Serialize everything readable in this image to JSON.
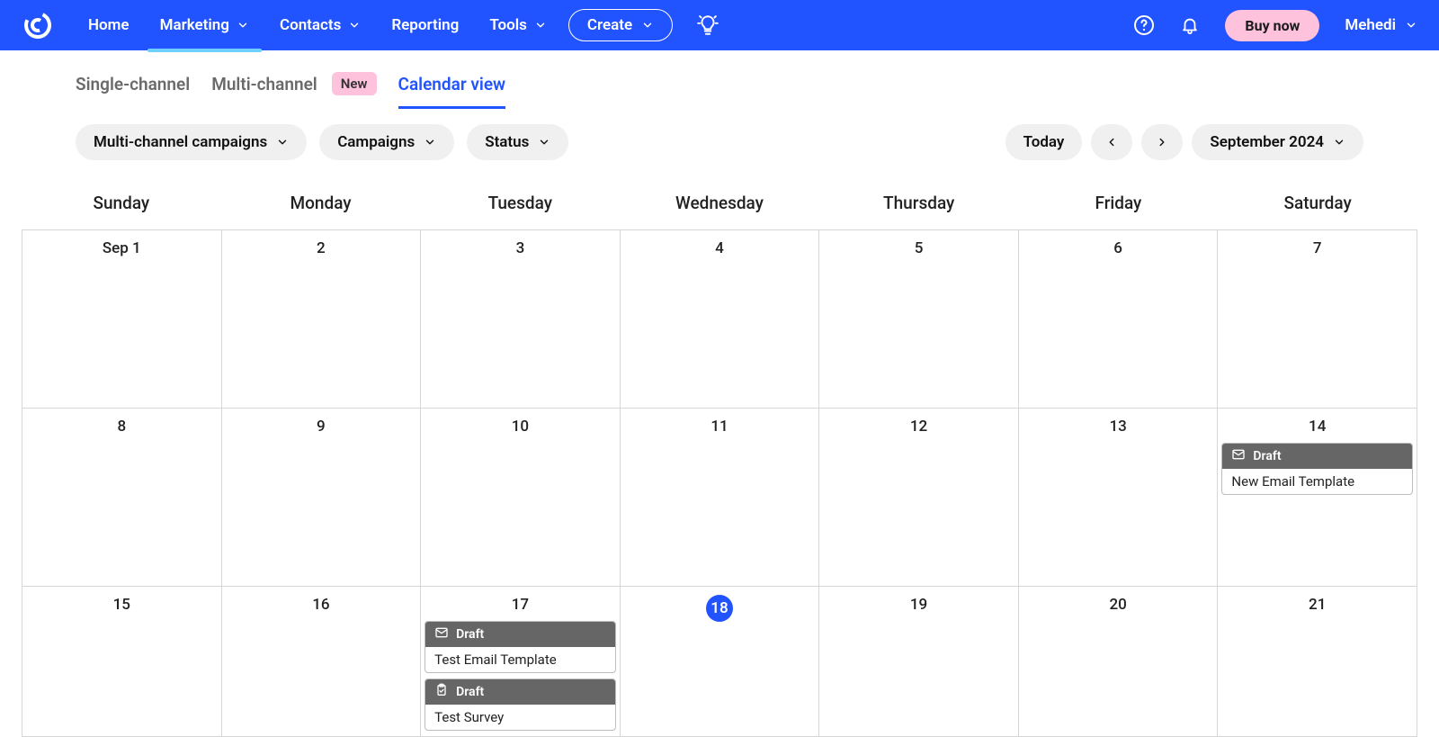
{
  "nav": {
    "items": [
      {
        "label": "Home",
        "has_chev": false
      },
      {
        "label": "Marketing",
        "has_chev": true,
        "active": true
      },
      {
        "label": "Contacts",
        "has_chev": true
      },
      {
        "label": "Reporting",
        "has_chev": false
      },
      {
        "label": "Tools",
        "has_chev": true
      }
    ],
    "create_label": "Create",
    "buy_label": "Buy now",
    "user_name": "Mehedi"
  },
  "tabs": {
    "single": "Single-channel",
    "multi": "Multi-channel",
    "new_badge": "New",
    "calendar": "Calendar view"
  },
  "filters": {
    "multi_channel": "Multi-channel campaigns",
    "campaigns": "Campaigns",
    "status": "Status",
    "today": "Today",
    "month_label": "September 2024"
  },
  "day_names": [
    "Sunday",
    "Monday",
    "Tuesday",
    "Wednesday",
    "Thursday",
    "Friday",
    "Saturday"
  ],
  "today_date": "18",
  "weeks": [
    {
      "dates": [
        "Sep 1",
        "2",
        "3",
        "4",
        "5",
        "6",
        "7"
      ],
      "events": {}
    },
    {
      "dates": [
        "8",
        "9",
        "10",
        "11",
        "12",
        "13",
        "14"
      ],
      "events": {
        "6": [
          {
            "status": "Draft",
            "title": "New Email Template",
            "icon": "mail"
          }
        ]
      }
    },
    {
      "dates": [
        "15",
        "16",
        "17",
        "18",
        "19",
        "20",
        "21"
      ],
      "short": true,
      "events": {
        "2": [
          {
            "status": "Draft",
            "title": "Test Email Template",
            "icon": "mail"
          },
          {
            "status": "Draft",
            "title": "Test Survey",
            "icon": "clipboard"
          }
        ]
      }
    }
  ]
}
